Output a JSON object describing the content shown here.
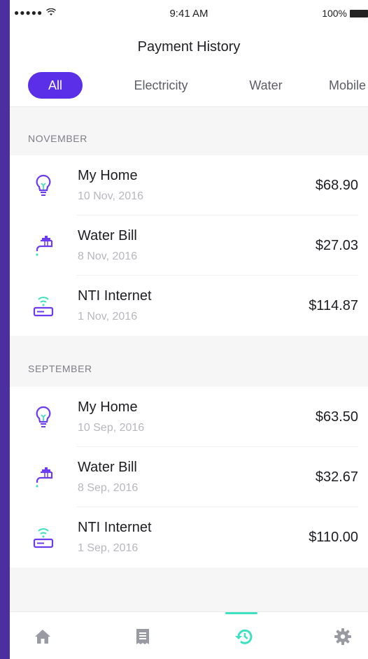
{
  "status_bar": {
    "signal": "●●●●● ",
    "time": "9:41 AM",
    "battery_text": "100%"
  },
  "header": {
    "title": "Payment History"
  },
  "tabs": [
    {
      "label": "All",
      "active": true
    },
    {
      "label": "Electricity",
      "active": false
    },
    {
      "label": "Water",
      "active": false
    },
    {
      "label": "Mobile",
      "active": false
    }
  ],
  "sections": [
    {
      "label": "NOVEMBER",
      "items": [
        {
          "name": "My Home",
          "date": "10 Nov, 2016",
          "amount": "$68.90",
          "icon": "lightbulb-icon"
        },
        {
          "name": "Water Bill",
          "date": "8 Nov, 2016",
          "amount": "$27.03",
          "icon": "faucet-icon"
        },
        {
          "name": "NTI Internet",
          "date": "1 Nov, 2016",
          "amount": "$114.87",
          "icon": "router-icon"
        }
      ]
    },
    {
      "label": "SEPTEMBER",
      "items": [
        {
          "name": "My Home",
          "date": "10 Sep, 2016",
          "amount": "$63.50",
          "icon": "lightbulb-icon"
        },
        {
          "name": "Water Bill",
          "date": "8 Sep, 2016",
          "amount": "$32.67",
          "icon": "faucet-icon"
        },
        {
          "name": "NTI Internet",
          "date": "1 Sep, 2016",
          "amount": "$110.00",
          "icon": "router-icon"
        }
      ]
    }
  ],
  "bottom_nav": [
    {
      "icon": "home-icon",
      "active": false
    },
    {
      "icon": "receipt-icon",
      "active": false
    },
    {
      "icon": "history-icon",
      "active": true
    },
    {
      "icon": "gear-icon",
      "active": false
    }
  ],
  "colors": {
    "accent": "#5b2ee8",
    "teal": "#3ee0c2",
    "nav_inactive": "#9a9aa3",
    "frame": "#4b2f9f"
  }
}
